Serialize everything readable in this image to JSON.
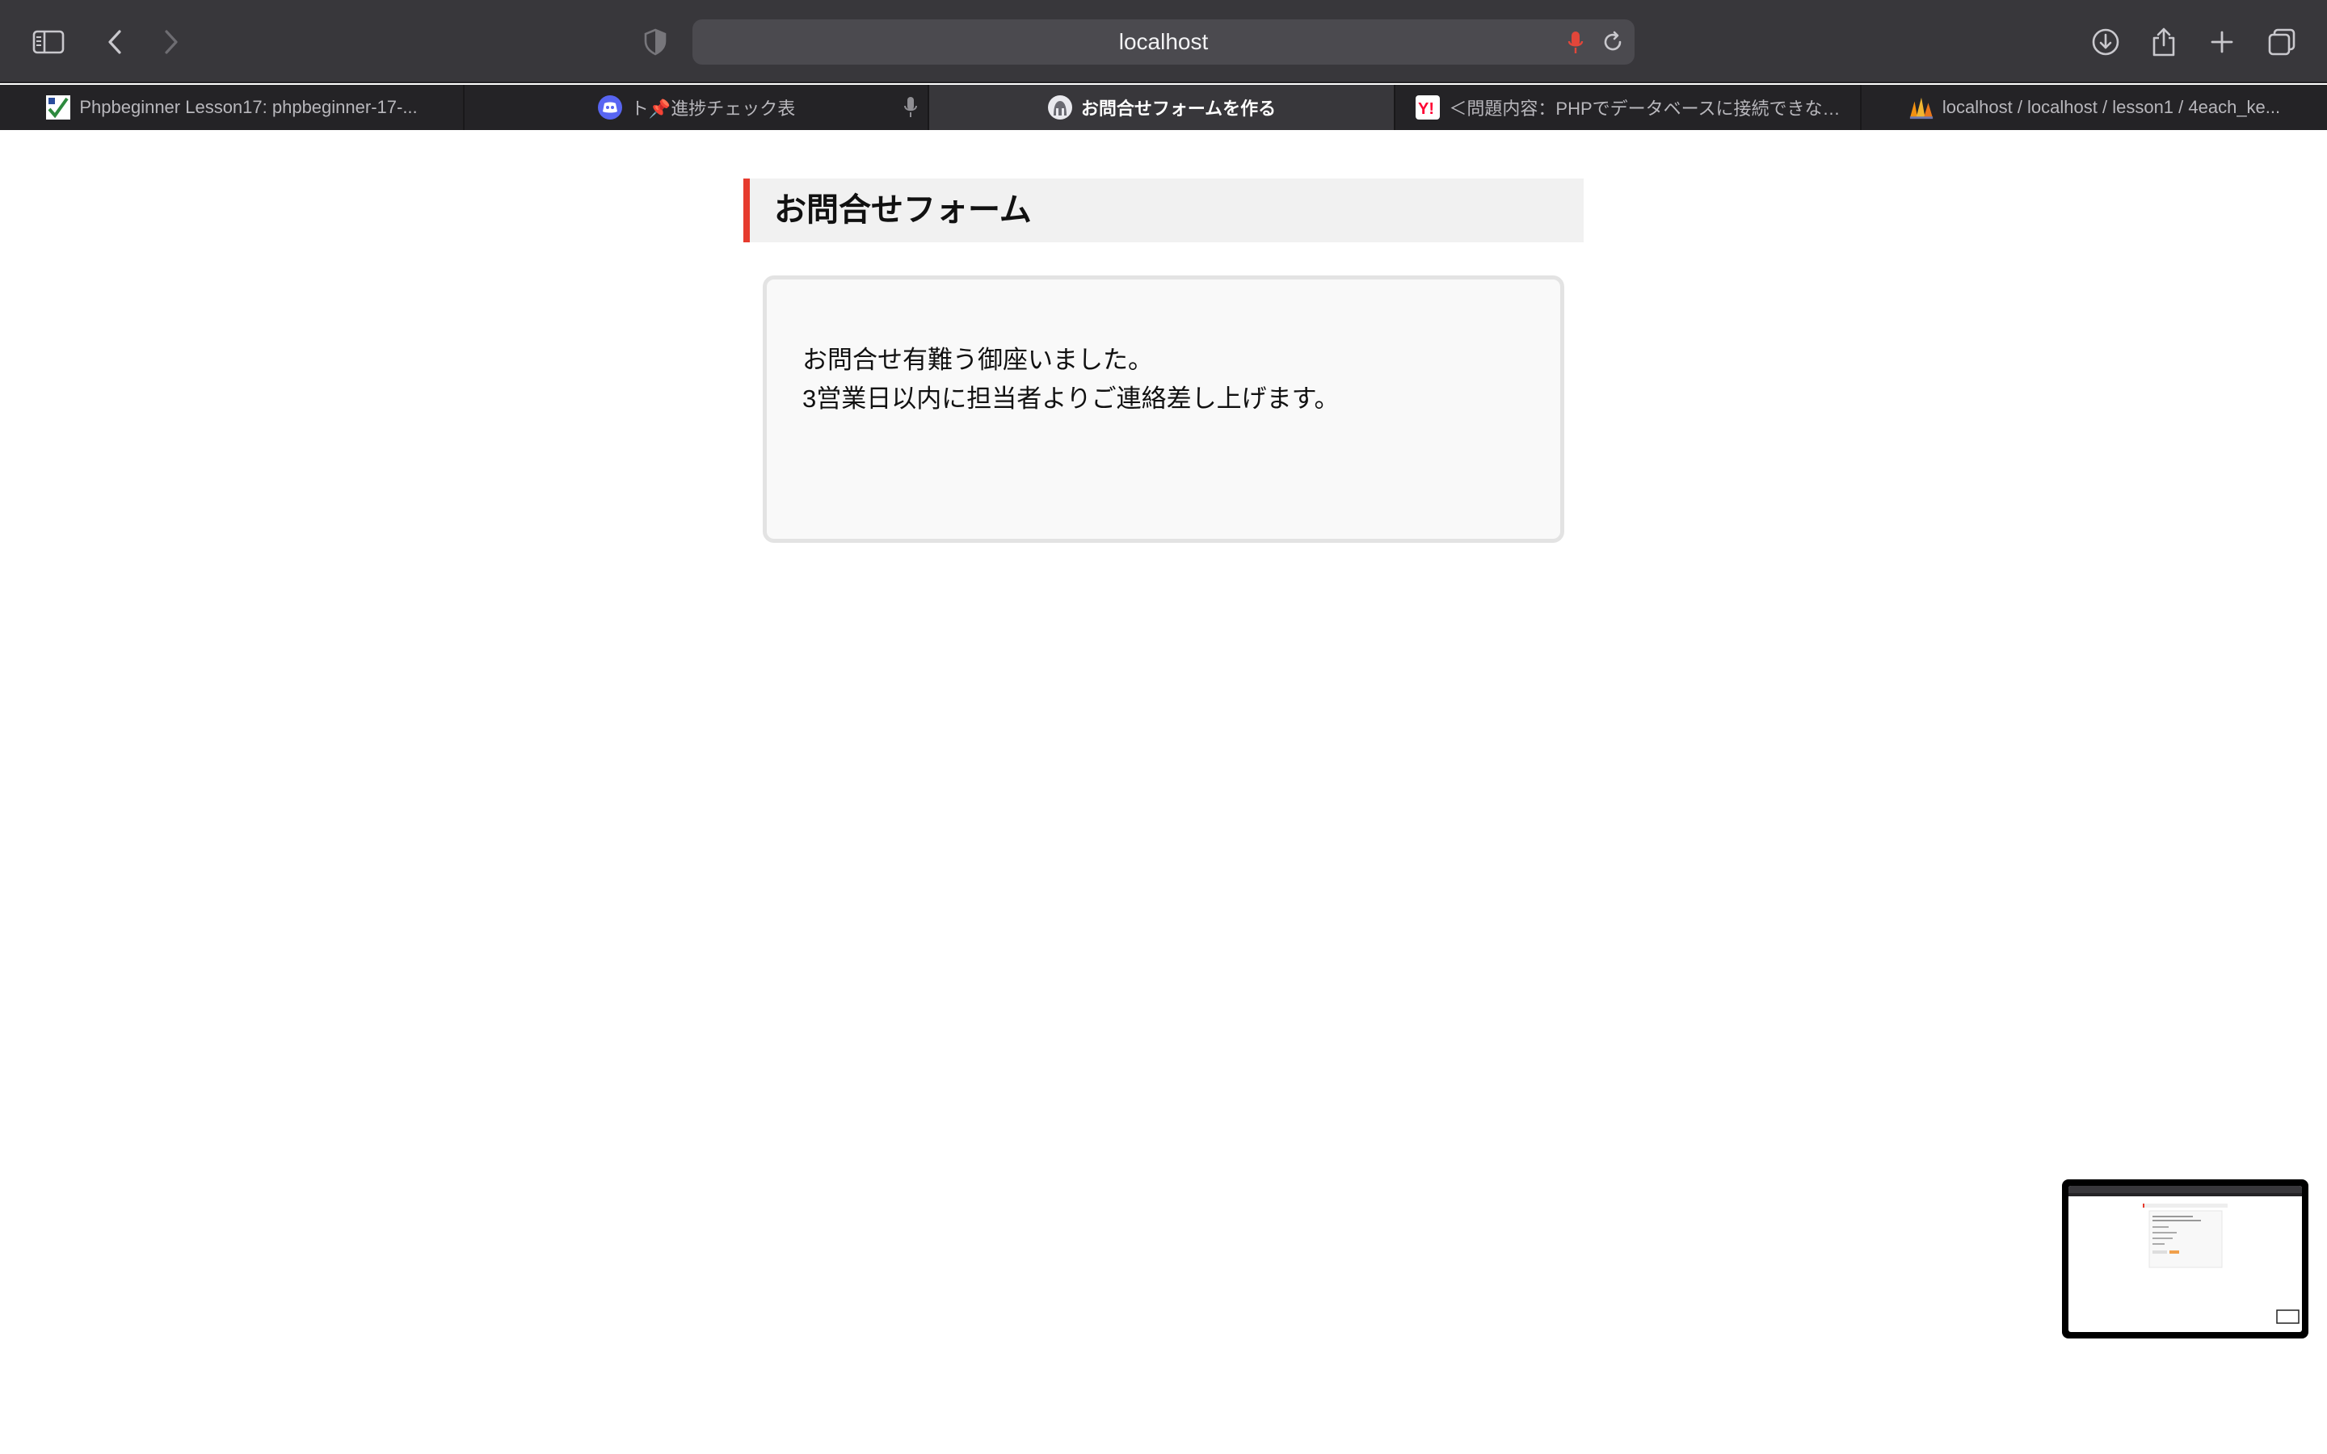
{
  "browser": {
    "url": "localhost",
    "tabs": [
      {
        "title": "Phpbeginner Lesson17: phpbeginner-17-...",
        "active": false,
        "favicon": "pencil-check-icon"
      },
      {
        "title": "ト📌進捗チェック表",
        "active": false,
        "favicon": "discord-icon"
      },
      {
        "title": "お問合せフォームを作る",
        "active": true,
        "favicon": "mascot-icon"
      },
      {
        "title": "＜問題内容：PHPでデータベースに接続できな…",
        "active": false,
        "favicon": "yahoo-icon"
      },
      {
        "title": "localhost / localhost / lesson1 / 4each_ke...",
        "active": false,
        "favicon": "phpmyadmin-icon"
      }
    ],
    "colors": {
      "toolbar": "#38373b",
      "tabstrip": "#242326",
      "active_tab": "#38373b",
      "mic_accent": "#e2463a"
    }
  },
  "page": {
    "heading": "お問合せフォーム",
    "message_lines": [
      "お問合せ有難う御座いました。",
      "3営業日以内に担当者よりご連絡差し上げます。"
    ],
    "colors": {
      "heading_accent": "#e63b2e",
      "heading_bg": "#f1f1f1",
      "card_bg": "#f9f9f9",
      "card_border": "#e3e3e3"
    }
  }
}
